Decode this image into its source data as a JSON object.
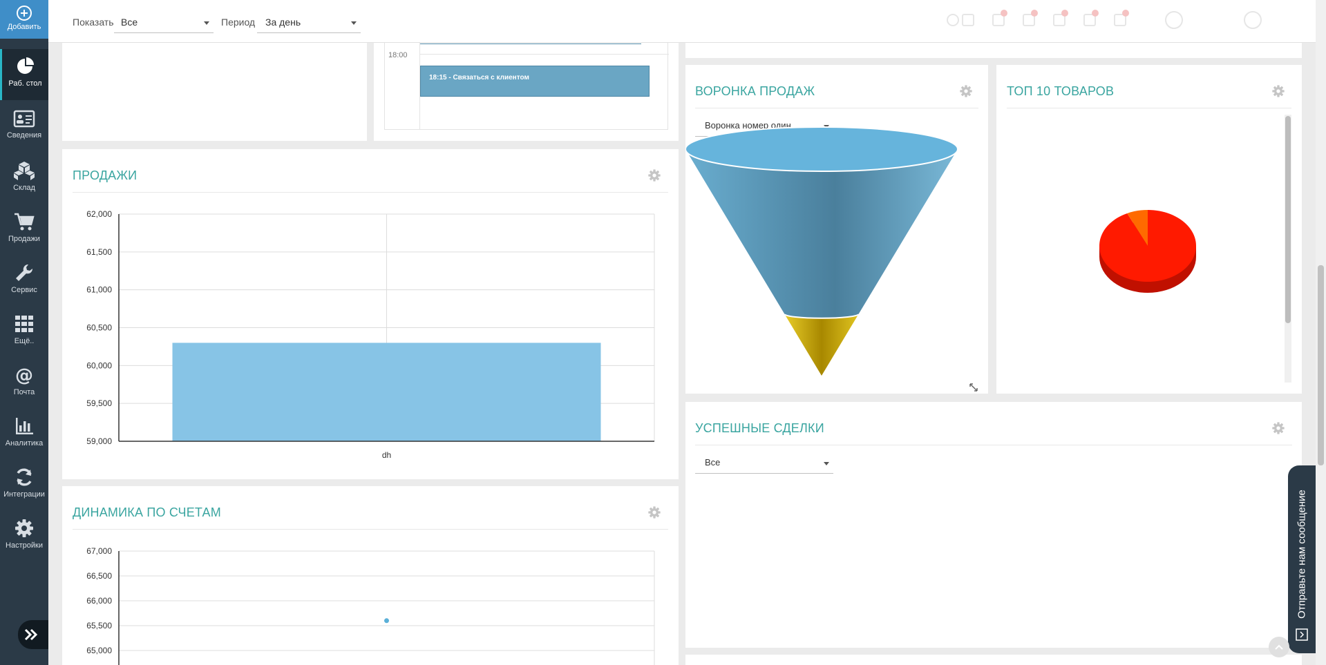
{
  "sidebar": {
    "add_label": "Добавить",
    "items": [
      {
        "label": "Раб. стол",
        "icon": "pie-chart-icon"
      },
      {
        "label": "Сведения",
        "icon": "id-card-icon"
      },
      {
        "label": "Склад",
        "icon": "boxes-icon"
      },
      {
        "label": "Продажи",
        "icon": "cart-icon"
      },
      {
        "label": "Сервис",
        "icon": "wrench-icon"
      },
      {
        "label": "Ещё..",
        "icon": "grid-icon"
      },
      {
        "label": "Почта",
        "icon": "at-icon"
      },
      {
        "label": "Аналитика",
        "icon": "bar-chart-icon"
      },
      {
        "label": "Интеграции",
        "icon": "sync-icon"
      },
      {
        "label": "Настройки",
        "icon": "gear-icon"
      }
    ]
  },
  "topbar": {
    "show_label": "Показать",
    "show_value": "Все",
    "period_label": "Период",
    "period_value": "За день"
  },
  "calendar": {
    "time_label": "18:00",
    "event_text": "18:15 - Связаться с клиентом"
  },
  "sales": {
    "title": "ПРОДАЖИ"
  },
  "funnel": {
    "title": "ВОРОНКА ПРОДАЖ",
    "select_value": "Воронка номер один",
    "colors": {
      "top": "#4d87a5",
      "bottom": "#c8a500"
    }
  },
  "top10": {
    "title": "ТОП 10 ТОВАРОВ",
    "colors": {
      "main": "#ff1a00",
      "slice": "#ff6a00"
    }
  },
  "deals": {
    "title": "УСПЕШНЫЕ СДЕЛКИ",
    "select_value": "Все"
  },
  "invoices": {
    "title": "ДИНАМИКА ПО СЧЕТАМ"
  },
  "feedback": {
    "label": "Отправьте нам сообщение"
  },
  "chart_data": [
    {
      "type": "bar",
      "categories": [
        "dh"
      ],
      "values": [
        60300
      ],
      "ylim": [
        59000,
        62000
      ],
      "yticks": [
        59000,
        59500,
        60000,
        60500,
        61000,
        61500,
        62000
      ],
      "ytick_labels": [
        "59,000",
        "59,500",
        "60,000",
        "60,500",
        "61,000",
        "61,500",
        "62,000"
      ],
      "grid": true,
      "color": "#87c4e6"
    },
    {
      "type": "scatter",
      "x": [
        0.5
      ],
      "y": [
        65600
      ],
      "ylim": [
        65000,
        67000
      ],
      "yticks": [
        65000,
        65500,
        66000,
        66500,
        67000
      ],
      "ytick_labels": [
        "65,000",
        "65,500",
        "66,000",
        "66,500",
        "67,000"
      ],
      "grid": true,
      "color": "#5bb0d8"
    },
    {
      "type": "pie",
      "values": [
        93,
        7
      ],
      "colors": [
        "#ff1a00",
        "#ff6a00"
      ]
    },
    {
      "type": "funnel",
      "values": [
        80,
        20
      ],
      "colors": [
        "#4d87a5",
        "#c8a500"
      ]
    }
  ]
}
